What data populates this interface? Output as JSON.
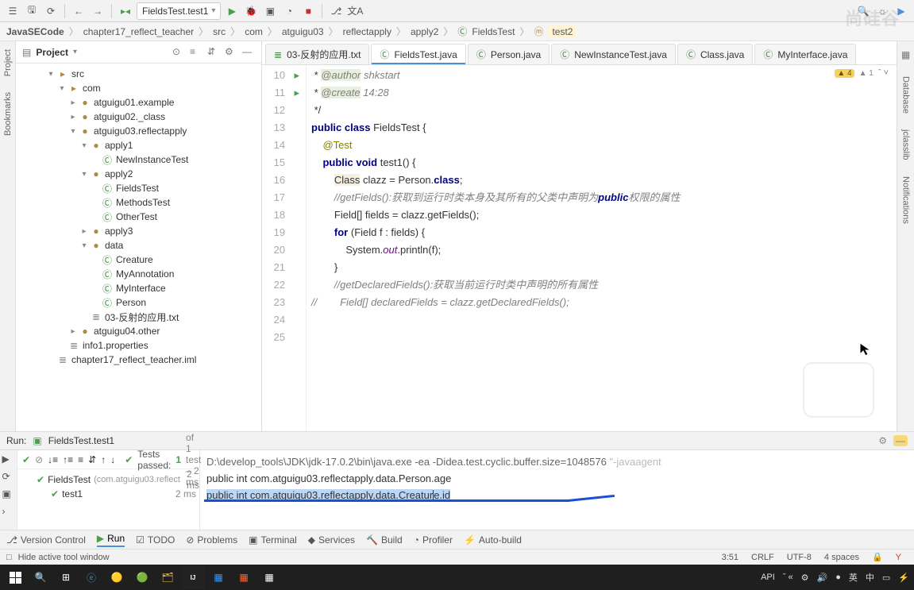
{
  "toolbar": {
    "run_config": "FieldsTest.test1"
  },
  "crumbs": [
    "JavaSECode",
    "chapter17_reflect_teacher",
    "src",
    "com",
    "atguigu03",
    "reflectapply",
    "apply2",
    "FieldsTest",
    "test2"
  ],
  "project": {
    "title": "Project",
    "tree": [
      {
        "ind": 40,
        "ar": "▾",
        "ic": "folder",
        "label": "src"
      },
      {
        "ind": 54,
        "ar": "▾",
        "ic": "folder",
        "label": "com"
      },
      {
        "ind": 68,
        "ar": "▸",
        "ic": "pkg",
        "label": "atguigu01.example"
      },
      {
        "ind": 68,
        "ar": "▸",
        "ic": "pkg",
        "label": "atguigu02._class"
      },
      {
        "ind": 68,
        "ar": "▾",
        "ic": "pkg",
        "label": "atguigu03.reflectapply"
      },
      {
        "ind": 82,
        "ar": "▾",
        "ic": "pkg",
        "label": "apply1"
      },
      {
        "ind": 96,
        "ar": "",
        "ic": "cls",
        "label": "NewInstanceTest"
      },
      {
        "ind": 82,
        "ar": "▾",
        "ic": "pkg",
        "label": "apply2"
      },
      {
        "ind": 96,
        "ar": "",
        "ic": "cls",
        "label": "FieldsTest"
      },
      {
        "ind": 96,
        "ar": "",
        "ic": "cls",
        "label": "MethodsTest"
      },
      {
        "ind": 96,
        "ar": "",
        "ic": "cls",
        "label": "OtherTest"
      },
      {
        "ind": 82,
        "ar": "▸",
        "ic": "pkg",
        "label": "apply3"
      },
      {
        "ind": 82,
        "ar": "▾",
        "ic": "pkg",
        "label": "data"
      },
      {
        "ind": 96,
        "ar": "",
        "ic": "cls",
        "label": "Creature"
      },
      {
        "ind": 96,
        "ar": "",
        "ic": "cls",
        "label": "MyAnnotation"
      },
      {
        "ind": 96,
        "ar": "",
        "ic": "cls",
        "label": "MyInterface"
      },
      {
        "ind": 96,
        "ar": "",
        "ic": "cls",
        "label": "Person"
      },
      {
        "ind": 82,
        "ar": "",
        "ic": "txtf",
        "label": "03-反射的应用.txt"
      },
      {
        "ind": 68,
        "ar": "▸",
        "ic": "pkg",
        "label": "atguigu04.other"
      },
      {
        "ind": 54,
        "ar": "",
        "ic": "txtf",
        "label": "info1.properties"
      },
      {
        "ind": 40,
        "ar": "",
        "ic": "txtf",
        "label": "chapter17_reflect_teacher.iml"
      }
    ]
  },
  "tabs": [
    {
      "label": "03-反射的应用.txt",
      "ic": "txt"
    },
    {
      "label": "FieldsTest.java",
      "ic": "cls",
      "active": true
    },
    {
      "label": "Person.java",
      "ic": "cls"
    },
    {
      "label": "NewInstanceTest.java",
      "ic": "cls"
    },
    {
      "label": "Class.java",
      "ic": "cls"
    },
    {
      "label": "MyInterface.java",
      "ic": "cls"
    }
  ],
  "code": {
    "start": 10,
    "lines": [
      " * @author shkstart",
      " * @create 14:28",
      " */",
      "public class FieldsTest {",
      "    @Test",
      "    public void test1() {",
      "",
      "        Class clazz = Person.class;",
      "        //getFields():获取到运行时类本身及其所有的父类中声明为public权限的属性",
      "        Field[] fields = clazz.getFields();",
      "        for (Field f : fields) {",
      "            System.out.println(f);",
      "        }",
      "",
      "        //getDeclaredFields():获取当前运行时类中声明的所有属性",
      "//        Field[] declaredFields = clazz.getDeclaredFields();"
    ],
    "run_marks": {
      "13": true,
      "15": true
    },
    "warn_text": "4",
    "gray_text": "1"
  },
  "run": {
    "title": "Run:",
    "config": "FieldsTest.test1",
    "passed_label": "Tests passed:",
    "passed_num": "1",
    "passed_rest": "of 1 test – 2 ms",
    "tree": [
      {
        "i": 20,
        "ok": true,
        "label": "FieldsTest",
        "ctx": "(com.atguigu03.reflect",
        "time": "2 ms"
      },
      {
        "i": 38,
        "ok": true,
        "label": "test1",
        "ctx": "",
        "time": "2 ms"
      }
    ],
    "out": [
      "D:\\develop_tools\\JDK\\jdk-17.0.2\\bin\\java.exe -ea -Didea.test.cyclic.buffer.size=1048576 \"-javaagent",
      "public int com.atguigu03.reflectapply.data.Person.age",
      "public int com.atguigu03.reflectapply.data.Creature.id"
    ]
  },
  "bottombar": [
    "Version Control",
    "Run",
    "TODO",
    "Problems",
    "Terminal",
    "Services",
    "Build",
    "Profiler",
    "Auto-build"
  ],
  "status": {
    "hint": "Hide active tool window",
    "pos": "3:51",
    "eol": "CRLF",
    "enc": "UTF-8",
    "indent": "4 spaces"
  },
  "taskbar": {
    "api": "API",
    "zh1": "英",
    "zh2": "中"
  },
  "watermark": "尚硅谷"
}
